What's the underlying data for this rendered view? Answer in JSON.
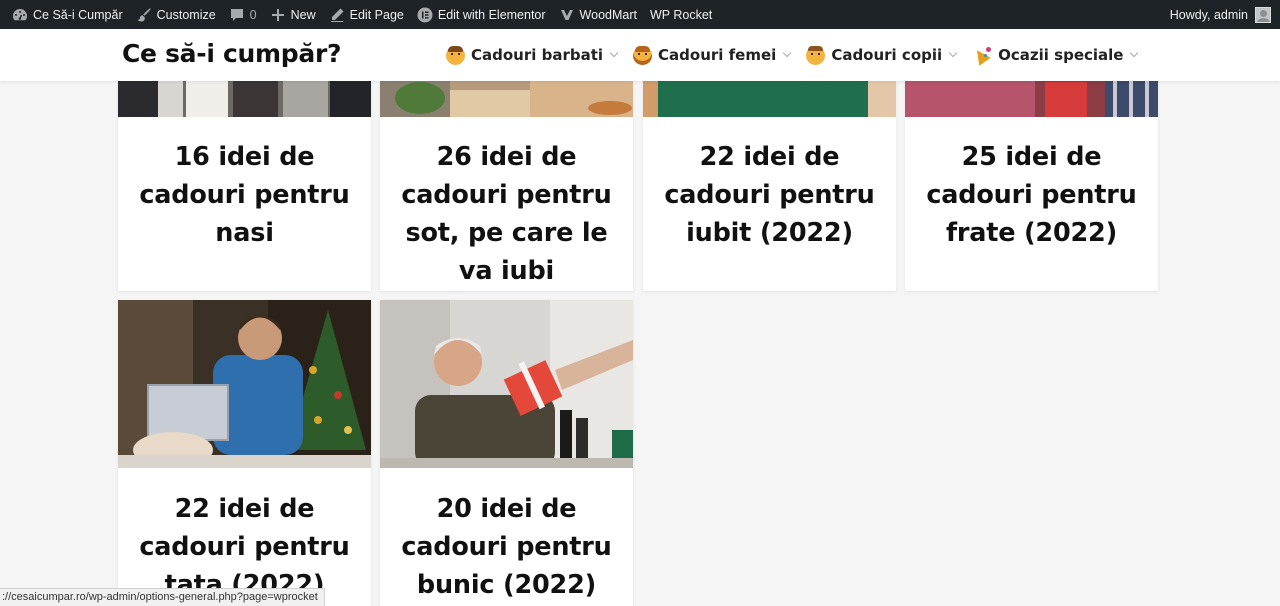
{
  "admin_bar": {
    "site_name": "Ce Să-i Cumpăr",
    "customize": "Customize",
    "comments_count": "0",
    "new": "New",
    "edit_page": "Edit Page",
    "edit_elementor": "Edit with Elementor",
    "woodmart": "WoodMart",
    "wp_rocket": "WP Rocket",
    "howdy": "Howdy, admin"
  },
  "header": {
    "logo": "Ce să-i cumpăr?",
    "nav": [
      {
        "label": "Cadouri barbati",
        "icon": "man-emoji-icon"
      },
      {
        "label": "Cadouri femei",
        "icon": "woman-emoji-icon"
      },
      {
        "label": "Cadouri copii",
        "icon": "child-emoji-icon"
      },
      {
        "label": "Ocazii speciale",
        "icon": "party-popper-icon"
      }
    ]
  },
  "cards": [
    {
      "title": "16 idei de cadouri pentru nasi"
    },
    {
      "title": "26 idei de cadouri pentru sot, pe care le va iubi"
    },
    {
      "title": "22 idei de cadouri pentru iubit (2022)"
    },
    {
      "title": "25 idei de cadouri pentru frate (2022)"
    },
    {
      "title": "22 idei de cadouri pentru tata (2022)"
    },
    {
      "title": "20 idei de cadouri pentru bunic (2022)"
    }
  ],
  "status_url": "://cesaicumpar.ro/wp-admin/options-general.php?page=wprocket"
}
